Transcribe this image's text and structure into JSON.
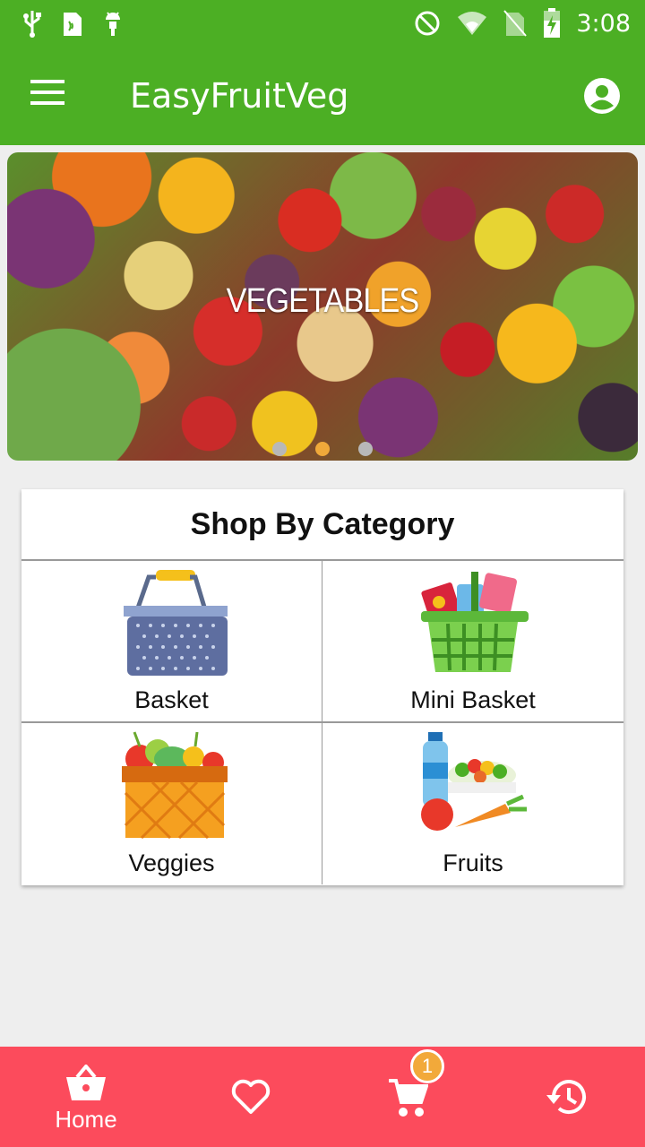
{
  "status_bar": {
    "time": "3:08"
  },
  "app_bar": {
    "title": "EasyFruitVeg"
  },
  "banner": {
    "caption": "VEGETABLES",
    "active_slide": 2,
    "slide_count": 3
  },
  "category_section": {
    "title": "Shop By Category",
    "items": [
      {
        "label": "Basket",
        "icon": "basket-icon"
      },
      {
        "label": "Mini Basket",
        "icon": "mini-basket-icon"
      },
      {
        "label": "Veggies",
        "icon": "veggies-crate-icon"
      },
      {
        "label": "Fruits",
        "icon": "fruits-groceries-icon"
      }
    ]
  },
  "bottom_nav": {
    "items": [
      {
        "label": "Home",
        "icon": "home-basket-icon"
      },
      {
        "label": "",
        "icon": "heart-icon"
      },
      {
        "label": "",
        "icon": "cart-icon"
      },
      {
        "label": "",
        "icon": "history-icon"
      }
    ],
    "cart_badge": "1"
  },
  "colors": {
    "primary": "#4caf24",
    "bottom_nav": "#fc4b5c",
    "accent": "#f2a93a"
  }
}
